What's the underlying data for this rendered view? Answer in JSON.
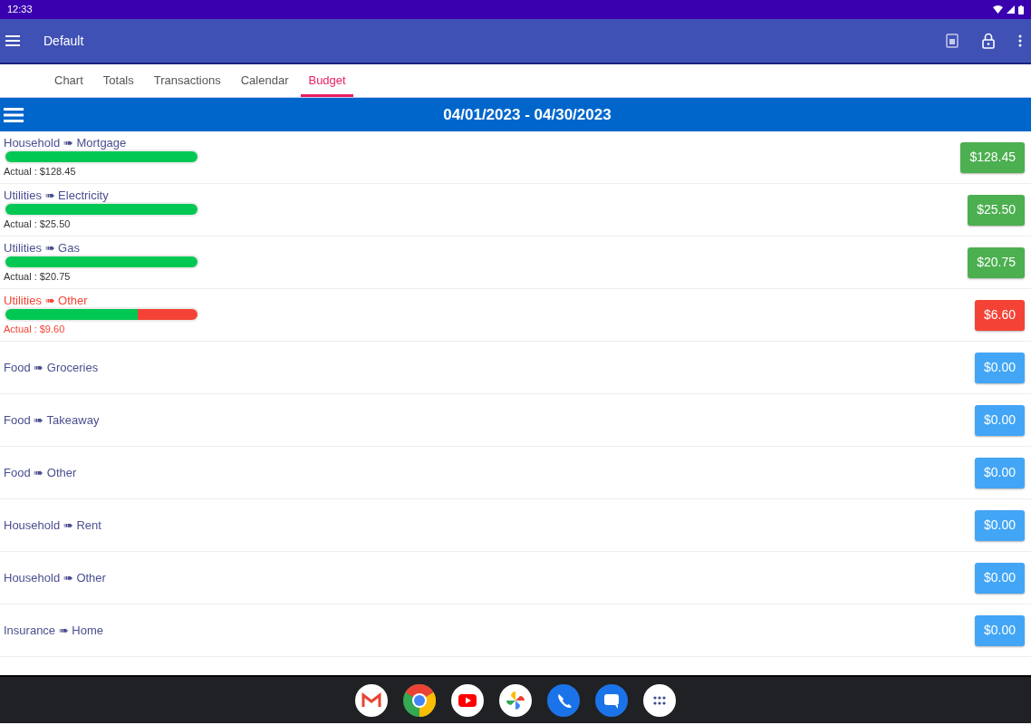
{
  "status_bar": {
    "time": "12:33"
  },
  "app_bar": {
    "title": "Default"
  },
  "tabs": [
    {
      "label": "Chart",
      "selected": false
    },
    {
      "label": "Totals",
      "selected": false
    },
    {
      "label": "Transactions",
      "selected": false
    },
    {
      "label": "Calendar",
      "selected": false
    },
    {
      "label": "Budget",
      "selected": true
    }
  ],
  "period": {
    "label": "04/01/2023 - 04/30/2023"
  },
  "rows": [
    {
      "kind": "budget",
      "color": "#4caf50",
      "over_budget": false,
      "category": "Household ➠ Mortgage",
      "level": 1,
      "actual": "Actual : $128.45",
      "amount": "$128.45"
    },
    {
      "kind": "budget",
      "color": "#4caf50",
      "over_budget": false,
      "category": "Utilities ➠ Electricity",
      "level": 1,
      "actual": "Actual : $25.50",
      "amount": "$25.50"
    },
    {
      "kind": "budget",
      "color": "#4caf50",
      "over_budget": false,
      "category": "Utilities ➠ Gas",
      "level": 1,
      "actual": "Actual : $20.75",
      "amount": "$20.75"
    },
    {
      "kind": "budget",
      "color": "#f44336",
      "over_budget": true,
      "category": "Utilities ➠ Other",
      "level": 0.69,
      "actual": "Actual : $9.60",
      "amount": "$6.60"
    },
    {
      "kind": "plain",
      "color": "#42a5f5",
      "over_budget": false,
      "category": "Food ➠ Groceries",
      "amount": "$0.00"
    },
    {
      "kind": "plain",
      "color": "#42a5f5",
      "over_budget": false,
      "category": "Food ➠ Takeaway",
      "amount": "$0.00"
    },
    {
      "kind": "plain",
      "color": "#42a5f5",
      "over_budget": false,
      "category": "Food ➠ Other",
      "amount": "$0.00"
    },
    {
      "kind": "plain",
      "color": "#42a5f5",
      "over_budget": false,
      "category": "Household ➠ Rent",
      "amount": "$0.00"
    },
    {
      "kind": "plain",
      "color": "#42a5f5",
      "over_budget": false,
      "category": "Household ➠ Other",
      "amount": "$0.00"
    },
    {
      "kind": "plain",
      "color": "#42a5f5",
      "over_budget": false,
      "category": "Insurance ➠ Home",
      "amount": "$0.00"
    }
  ]
}
